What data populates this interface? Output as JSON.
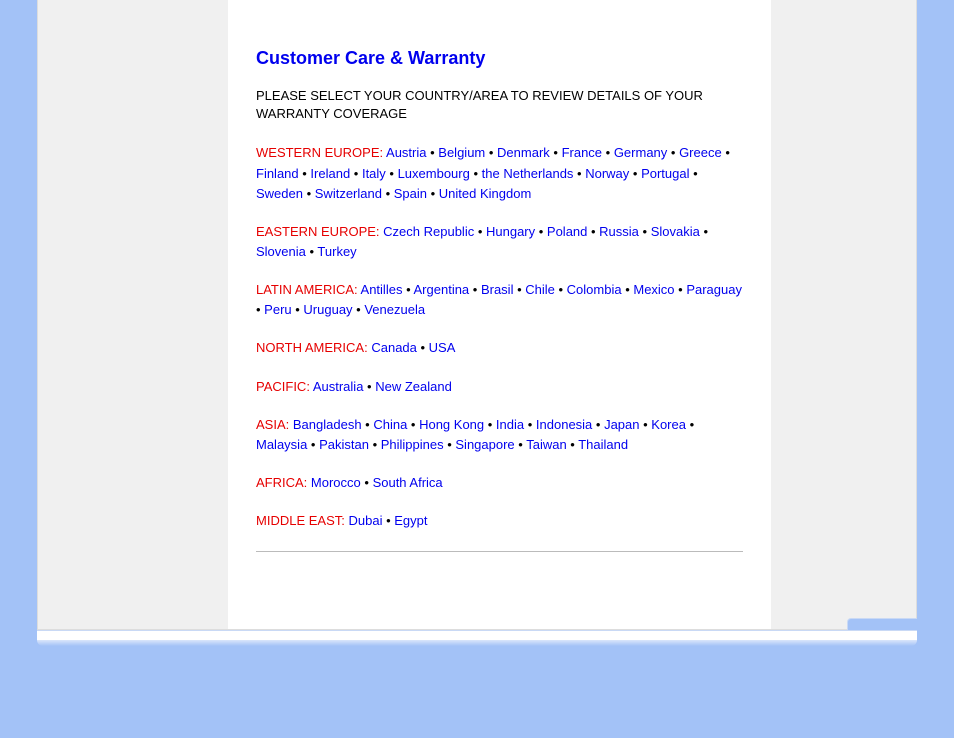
{
  "title": "Customer Care & Warranty",
  "instruction": "PLEASE SELECT YOUR COUNTRY/AREA TO REVIEW DETAILS OF YOUR WARRANTY COVERAGE",
  "regions": [
    {
      "label": "WESTERN EUROPE:",
      "countries": [
        "Austria",
        "Belgium",
        "Denmark",
        "France",
        "Germany",
        "Greece",
        "Finland",
        "Ireland",
        "Italy",
        "Luxembourg",
        "the Netherlands",
        "Norway",
        "Portugal",
        "Sweden",
        "Switzerland",
        "Spain",
        "United Kingdom"
      ]
    },
    {
      "label": "EASTERN EUROPE:",
      "countries": [
        "Czech Republic",
        "Hungary",
        "Poland",
        "Russia",
        "Slovakia",
        "Slovenia",
        "Turkey"
      ]
    },
    {
      "label": "LATIN AMERICA:",
      "countries": [
        "Antilles",
        "Argentina",
        "Brasil",
        "Chile",
        "Colombia",
        "Mexico",
        "Paraguay",
        "Peru",
        "Uruguay",
        "Venezuela"
      ]
    },
    {
      "label": "NORTH AMERICA:",
      "countries": [
        "Canada",
        "USA"
      ]
    },
    {
      "label": "PACIFIC:",
      "countries": [
        "Australia",
        "New Zealand"
      ]
    },
    {
      "label": "ASIA:",
      "countries": [
        "Bangladesh",
        "China",
        "Hong Kong",
        "India",
        "Indonesia",
        "Japan",
        "Korea",
        "Malaysia",
        "Pakistan",
        "Philippines",
        "Singapore",
        "Taiwan",
        "Thailand"
      ]
    },
    {
      "label": "AFRICA:",
      "countries": [
        "Morocco",
        "South Africa"
      ]
    },
    {
      "label": "MIDDLE EAST:",
      "countries": [
        "Dubai",
        "Egypt"
      ]
    }
  ]
}
